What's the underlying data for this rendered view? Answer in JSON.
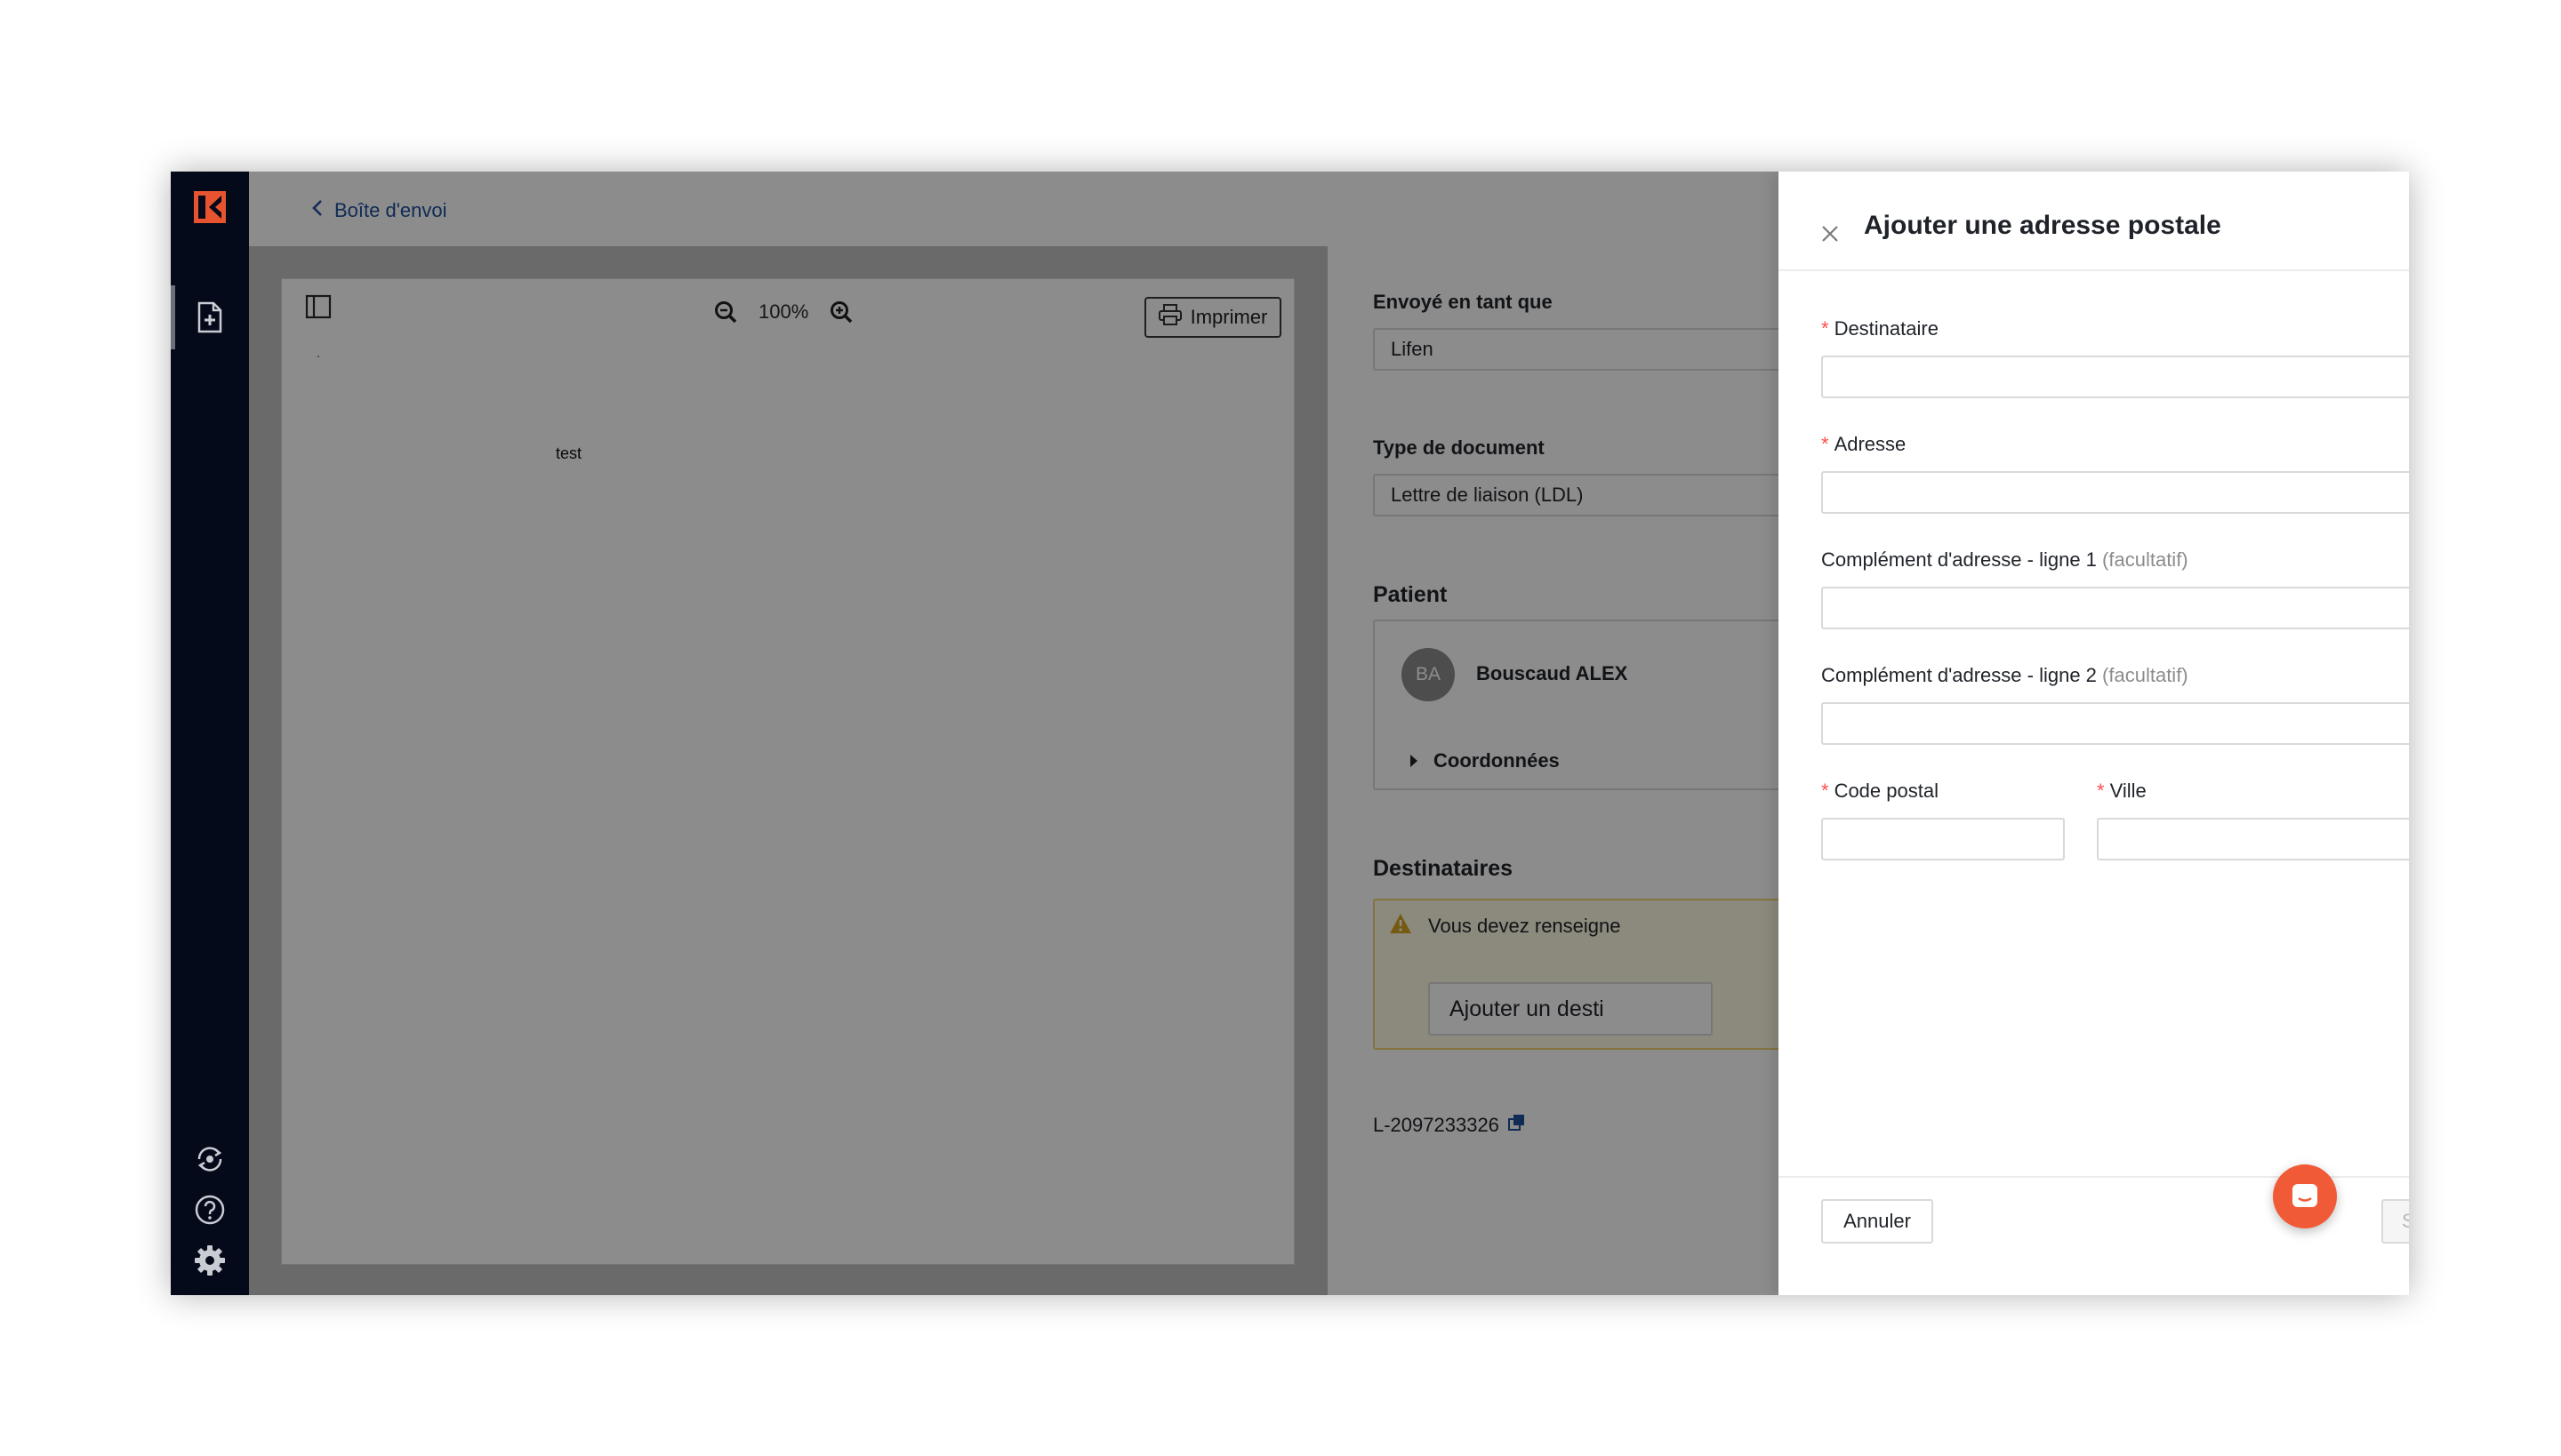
{
  "back_link": {
    "label": "Boîte d'envoi"
  },
  "viewer": {
    "zoom_label": "100%",
    "print_label": "Imprimer",
    "document_text": "test"
  },
  "info": {
    "sent_as_label": "Envoyé en tant que",
    "sent_as_value": "Lifen",
    "doc_type_label": "Type de document",
    "doc_type_value": "Lettre de liaison (LDL)",
    "patient_title": "Patient",
    "patient_initials": "BA",
    "patient_name": "Bouscaud ALEX",
    "coordinates_label": "Coordonnées",
    "recipients_title": "Destinataires",
    "warning_text": "Vous devez renseigne",
    "add_recipient_label": "Ajouter un desti",
    "document_id": "L-2097233326"
  },
  "drawer": {
    "title": "Ajouter une adresse postale",
    "fields": {
      "recipient": {
        "label": "Destinataire",
        "value": ""
      },
      "address": {
        "label": "Adresse",
        "value": ""
      },
      "complement1": {
        "label": "Complément d'adresse - ligne 1",
        "optional": "(facultatif)",
        "value": ""
      },
      "complement2": {
        "label": "Complément d'adresse - ligne 2",
        "optional": "(facultatif)",
        "value": ""
      },
      "postal_code": {
        "label": "Code postal",
        "value": ""
      },
      "city": {
        "label": "Ville",
        "value": ""
      }
    },
    "required_mark": "*",
    "cancel_label": "Annuler",
    "save_label": "Sauvegarder"
  },
  "colors": {
    "sidebar": "#040a1a",
    "accent_link": "#1e4f9a",
    "chat": "#f15a36",
    "required": "#ff4d4f",
    "warning_bg": "#fff9e4"
  },
  "icons": {
    "logo": "lifen-logo-icon",
    "documents": "file-plus-icon",
    "sync": "sync-icon",
    "help": "help-circle-icon",
    "settings": "gear-icon",
    "zoom_out": "zoom-out-icon",
    "zoom_in": "zoom-in-icon",
    "print": "printer-icon",
    "close": "close-icon",
    "chat": "chat-icon"
  }
}
